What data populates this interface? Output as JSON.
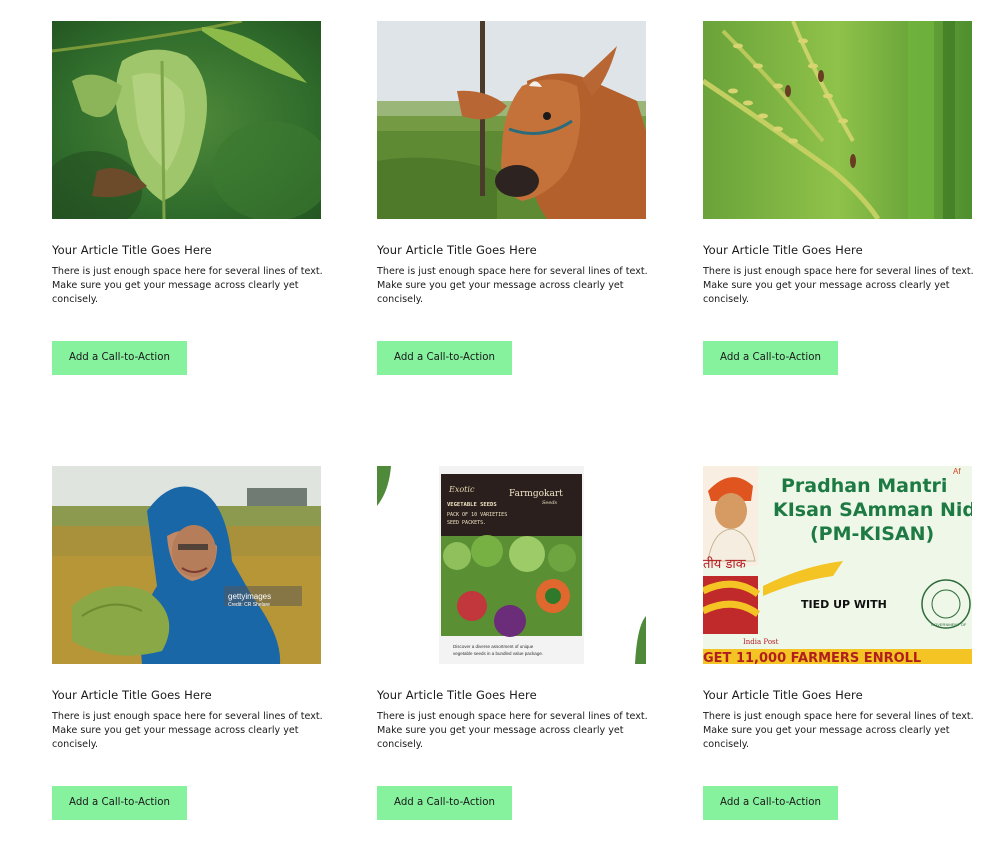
{
  "cards": [
    {
      "image_alt": "Curled diseased plant leaf",
      "title": "Your Article Title Goes Here",
      "body": "There is just enough space here for several lines of text. Make sure you get your message across clearly yet concisely.",
      "cta": "Add a Call-to-Action"
    },
    {
      "image_alt": "Brown calf resting in a grassy field",
      "title": "Your Article Title Goes Here",
      "body": "There is just enough space here for several lines of text. Make sure you get your message across clearly yet concisely.",
      "cta": "Add a Call-to-Action"
    },
    {
      "image_alt": "Rice panicles with grain disease",
      "title": "Your Article Title Goes Here",
      "body": "There is just enough space here for several lines of text. Make sure you get your message across clearly yet concisely.",
      "cta": "Add a Call-to-Action"
    },
    {
      "image_alt": "Smiling woman farmer in blue sari holding a harvest bundle",
      "title": "Your Article Title Goes Here",
      "body": "There is just enough space here for several lines of text. Make sure you get your message across clearly yet concisely.",
      "cta": "Add a Call-to-Action",
      "image_text": {
        "watermark": "gettyimages",
        "credit": "Credit: CR Shelare"
      }
    },
    {
      "image_alt": "Vegetable seeds pack",
      "title": "Your Article Title Goes Here",
      "body": "There is just enough space here for several lines of text. Make sure you get your message across clearly yet concisely.",
      "cta": "Add a Call-to-Action",
      "image_text": {
        "script": "Exotic",
        "brand": "Farmgokart",
        "brand_sub": "Seeds",
        "line1": "VEGETABLE SEEDS",
        "line2": "PACK OF 10 VARIETIES",
        "line3": "SEED PACKETS.",
        "footer1": "Discover a diverse assortment of unique",
        "footer2": "vegetable seeds in a bundled value package."
      }
    },
    {
      "image_alt": "PM-KISAN and India Post banner",
      "title": "Your Article Title Goes Here",
      "body": "There is just enough space here for several lines of text. Make sure you get your message across clearly yet concisely.",
      "cta": "Add a Call-to-Action",
      "image_text": {
        "headline1": "Pradhan Mantri",
        "headline2": "KIsan SAmman Nidhi",
        "headline3": "(PM-KISAN)",
        "corner": "Af",
        "hindi": "तीय डाक",
        "tied": "TIED UP WITH",
        "post": "India Post",
        "bottom": "GET 11,000 FARMERS ENROLL",
        "seal": "GOVERNMENT OF"
      }
    }
  ],
  "colors": {
    "cta_bg": "#86f29e",
    "text": "#1a1a1a"
  }
}
